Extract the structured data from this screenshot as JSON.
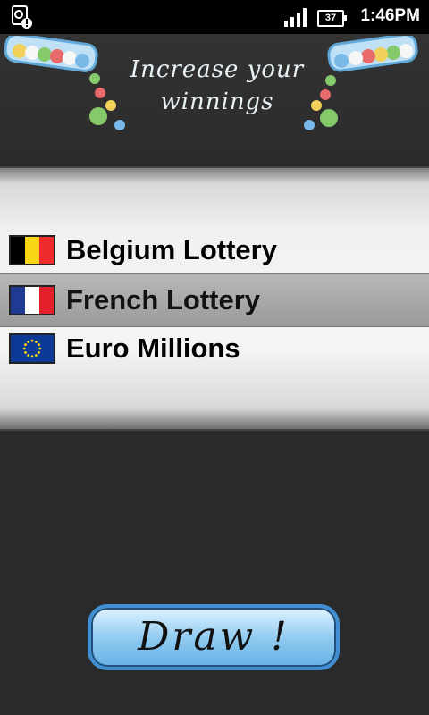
{
  "status_bar": {
    "time": "1:46PM",
    "battery": "37"
  },
  "header": {
    "title_line1": "Increase your",
    "title_line2": "winnings"
  },
  "lottery_list": [
    {
      "label": "Belgium Lottery",
      "flag": "belgium-flag",
      "colors": [
        "#000000",
        "#f9d616",
        "#ef2b2d"
      ]
    },
    {
      "label": "French Lottery",
      "flag": "france-flag",
      "colors": [
        "#1f3a93",
        "#ffffff",
        "#e4202a"
      ],
      "selected": true
    },
    {
      "label": "Euro Millions",
      "flag": "eu-flag",
      "colors": [
        "#0c3a96",
        "#f9d616"
      ]
    }
  ],
  "draw_button": {
    "label": "Draw !"
  },
  "accent": {
    "button_blue": "#3f8fd2"
  }
}
